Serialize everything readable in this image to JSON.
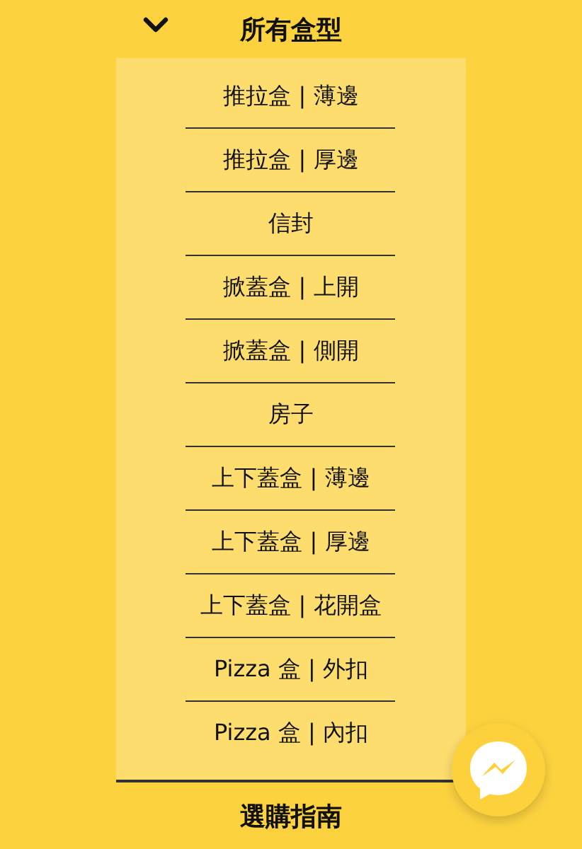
{
  "menu": {
    "title": "所有盒型",
    "expanded": true,
    "items": [
      {
        "label": "推拉盒 | 薄邊"
      },
      {
        "label": "推拉盒 | 厚邊"
      },
      {
        "label": "信封"
      },
      {
        "label": "掀蓋盒 | 上開"
      },
      {
        "label": "掀蓋盒 | 側開"
      },
      {
        "label": "房子"
      },
      {
        "label": "上下蓋盒 | 薄邊"
      },
      {
        "label": "上下蓋盒 | 厚邊"
      },
      {
        "label": "上下蓋盒 | 花開盒"
      },
      {
        "label": "Pizza 盒 | 外扣"
      },
      {
        "label": "Pizza 盒 | 內扣"
      }
    ]
  },
  "next_menu": {
    "title": "選購指南"
  }
}
